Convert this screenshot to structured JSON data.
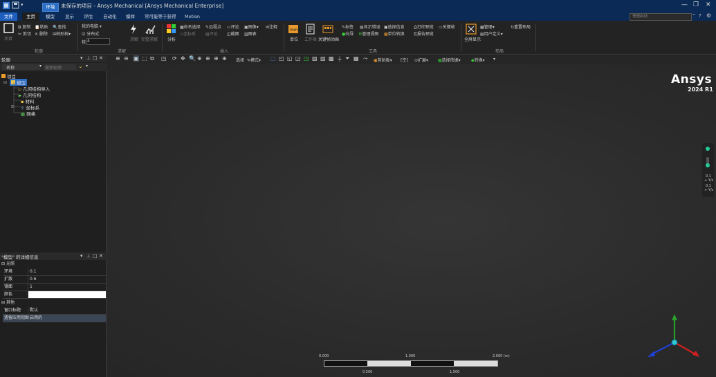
{
  "titlebar": {
    "context_tab": "环境",
    "title": "未保存的项目 - Ansys Mechanical [Ansys Mechanical Enterprise]"
  },
  "ribbon_tabs": [
    "文件",
    "主页",
    "模型",
    "显示",
    "评估",
    "自动化",
    "模样",
    "常可能等于获得",
    "Motion"
  ],
  "search_placeholder": "快速启动",
  "ribbon": {
    "outline_group": {
      "label": "轮廓",
      "copy": "复制",
      "cut": "剪切",
      "paste": "粘贴",
      "delete": "删除",
      "find": "查找",
      "tree": "树形树",
      "project": "项目"
    },
    "units_group": {
      "label": "求解",
      "cell": "我的电脑",
      "distributed": "分布式",
      "cores_label": "核",
      "cores_value": "4",
      "solve": "求解",
      "solve_process": "完整求解"
    },
    "insert_group": {
      "label": "插入",
      "analysis": "分析",
      "named_selection": "命名选择",
      "coordinate": "坐标系",
      "remote_point": "远程点",
      "comment": "评论",
      "image": "图像",
      "annotation": "注释",
      "section_plane": "截面",
      "table": "图表"
    },
    "tools_group": {
      "label": "工具",
      "units": "单位",
      "worksheet": "工作表",
      "key_assist": "关键帧动画",
      "tags": "标签",
      "show_error": "显示错误",
      "selection_info": "选择信息",
      "print_preview": "打印预览",
      "report_preview": "报告预览",
      "manage_views": "管理视图",
      "wizard": "向导",
      "reset": "重置",
      "key_frames": "关键帧",
      "unit_conversion": "单位转换"
    },
    "layout_group": {
      "label": "布局",
      "full_screen": "全屏显示",
      "manage": "管理",
      "user_defined": "用户定义",
      "reset_layout": "重置布局"
    }
  },
  "toolbar": {
    "select_label": "选择",
    "mode_label": "模式",
    "clipboard": "剪贴板",
    "empty": "[空]",
    "extend": "扩展",
    "select_by": "选择依据",
    "convert": "转换"
  },
  "outline": {
    "title": "轮廓",
    "name_filter": "名称",
    "search_placeholder": "搜索轮廓",
    "tree": [
      {
        "label": "项目",
        "level": 0
      },
      {
        "label": "模型",
        "level": 1
      },
      {
        "label": "几何结构导入",
        "level": 2
      },
      {
        "label": "几何结构",
        "level": 2
      },
      {
        "label": "材料",
        "level": 2
      },
      {
        "label": "坐标系",
        "level": 2
      },
      {
        "label": "网格",
        "level": 2
      }
    ]
  },
  "details": {
    "title": "\"模型\" 的详细信息",
    "sections": [
      {
        "title": "光照",
        "rows": [
          {
            "k": "环境",
            "v": "0.1"
          },
          {
            "k": "扩散",
            "v": "0.6"
          },
          {
            "k": "镜面",
            "v": "1"
          },
          {
            "k": "颜色",
            "v": ""
          }
        ]
      },
      {
        "title": "其他",
        "rows": [
          {
            "k": "窗口标题",
            "v": "默认"
          },
          {
            "k": "遗留应用视图",
            "v": "启用的"
          }
        ]
      }
    ]
  },
  "logo": {
    "name": "Ansys",
    "version": "2024 R1"
  },
  "scale_legend": {
    "v1": "0.1",
    "v1_unit": "+ Y/s",
    "v2": "0.1",
    "v2_unit": "+ Y/s"
  },
  "scale_bar": {
    "top": [
      "0.000",
      "1.000",
      "2.000 (m)"
    ],
    "bottom": [
      "0.500",
      "1.500"
    ]
  },
  "colors": {
    "titlebar": "#0b2a55",
    "accent": "#1f5fbf",
    "x_axis": "#d02020",
    "y_axis": "#2aa02a",
    "z_axis": "#2040d0"
  }
}
